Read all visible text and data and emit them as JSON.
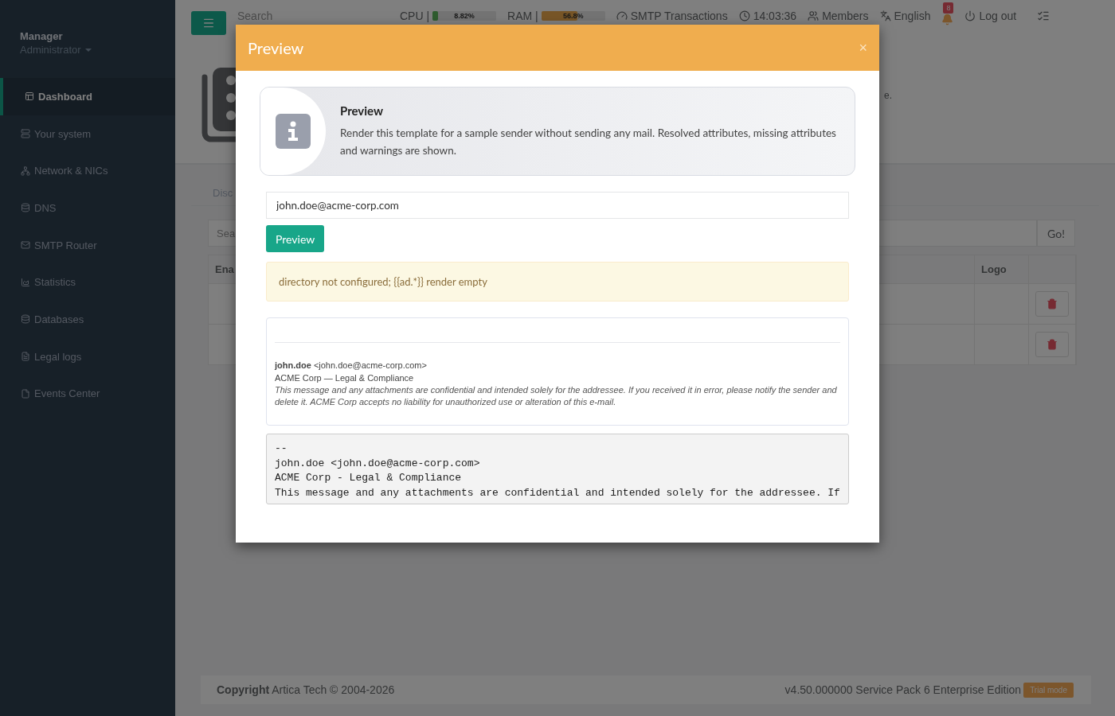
{
  "sidebar": {
    "user_name": "Manager",
    "user_role": "Administrator",
    "items": [
      {
        "label": "Dashboard",
        "selected": true
      },
      {
        "label": "Your system",
        "selected": false
      },
      {
        "label": "Network & NICs",
        "selected": false
      },
      {
        "label": "DNS",
        "selected": false
      },
      {
        "label": "SMTP Router",
        "selected": false
      },
      {
        "label": "Statistics",
        "selected": false
      },
      {
        "label": "Databases",
        "selected": false
      },
      {
        "label": "Legal logs",
        "selected": false
      },
      {
        "label": "Events Center",
        "selected": false
      }
    ]
  },
  "topbar": {
    "search_placeholder": "Search",
    "meters": [
      {
        "label": "CPU |",
        "level": 0.09,
        "reading": "8.82%",
        "kind": "ok"
      },
      {
        "label": "RAM |",
        "level": 0.57,
        "reading": "56.8%",
        "kind": "warning"
      }
    ],
    "links": [
      {
        "kind": "gauge",
        "label": "SMTP Transactions"
      },
      {
        "kind": "clock",
        "label": "14:03:36"
      },
      {
        "kind": "users",
        "label": "Members"
      },
      {
        "kind": "language",
        "label": "English"
      }
    ],
    "notifications": "8",
    "logout": "Log out"
  },
  "background": {
    "description_fragment": "e.",
    "tab_fragment": "Disc",
    "search_fragment": "Sea",
    "go_button": "Go!",
    "columns": [
      "Ena",
      "Logo"
    ],
    "rows": [
      {
        "deletable": true
      },
      {
        "deletable": true
      }
    ]
  },
  "modal": {
    "title": "Preview",
    "close": "×",
    "info": {
      "title": "Preview",
      "text": "Render this template for a sample sender without sending any mail. Resolved attributes, missing attributes and warnings are shown."
    },
    "email_value": "john.doe@acme-corp.com",
    "button": "Preview",
    "warning": "directory not configured; {{ad.*}} render empty",
    "signature_html": [
      "**john.doe** <john.doe@acme-corp.com>",
      "ACME Corp — Legal & Compliance"
    ],
    "signature_disclaimer": "This message and any attachments are confidential and intended solely for the addressee. If you received it in error, please notify the sender and delete it. ACME Corp accepts no liability for unauthorized use or alteration of this e-mail.",
    "signature_text": [
      "--",
      "john.doe <john.doe@acme-corp.com>",
      "ACME Corp - Legal & Compliance",
      "This message and any attachments are confidential and intended solely for the addressee. If"
    ]
  },
  "footer": {
    "copyright": "**Copyright** Artica Tech © 2004-2026",
    "version": "v4.50.000000 Service Pack 6 Enterprise Edition",
    "badge": "Trial mode"
  }
}
